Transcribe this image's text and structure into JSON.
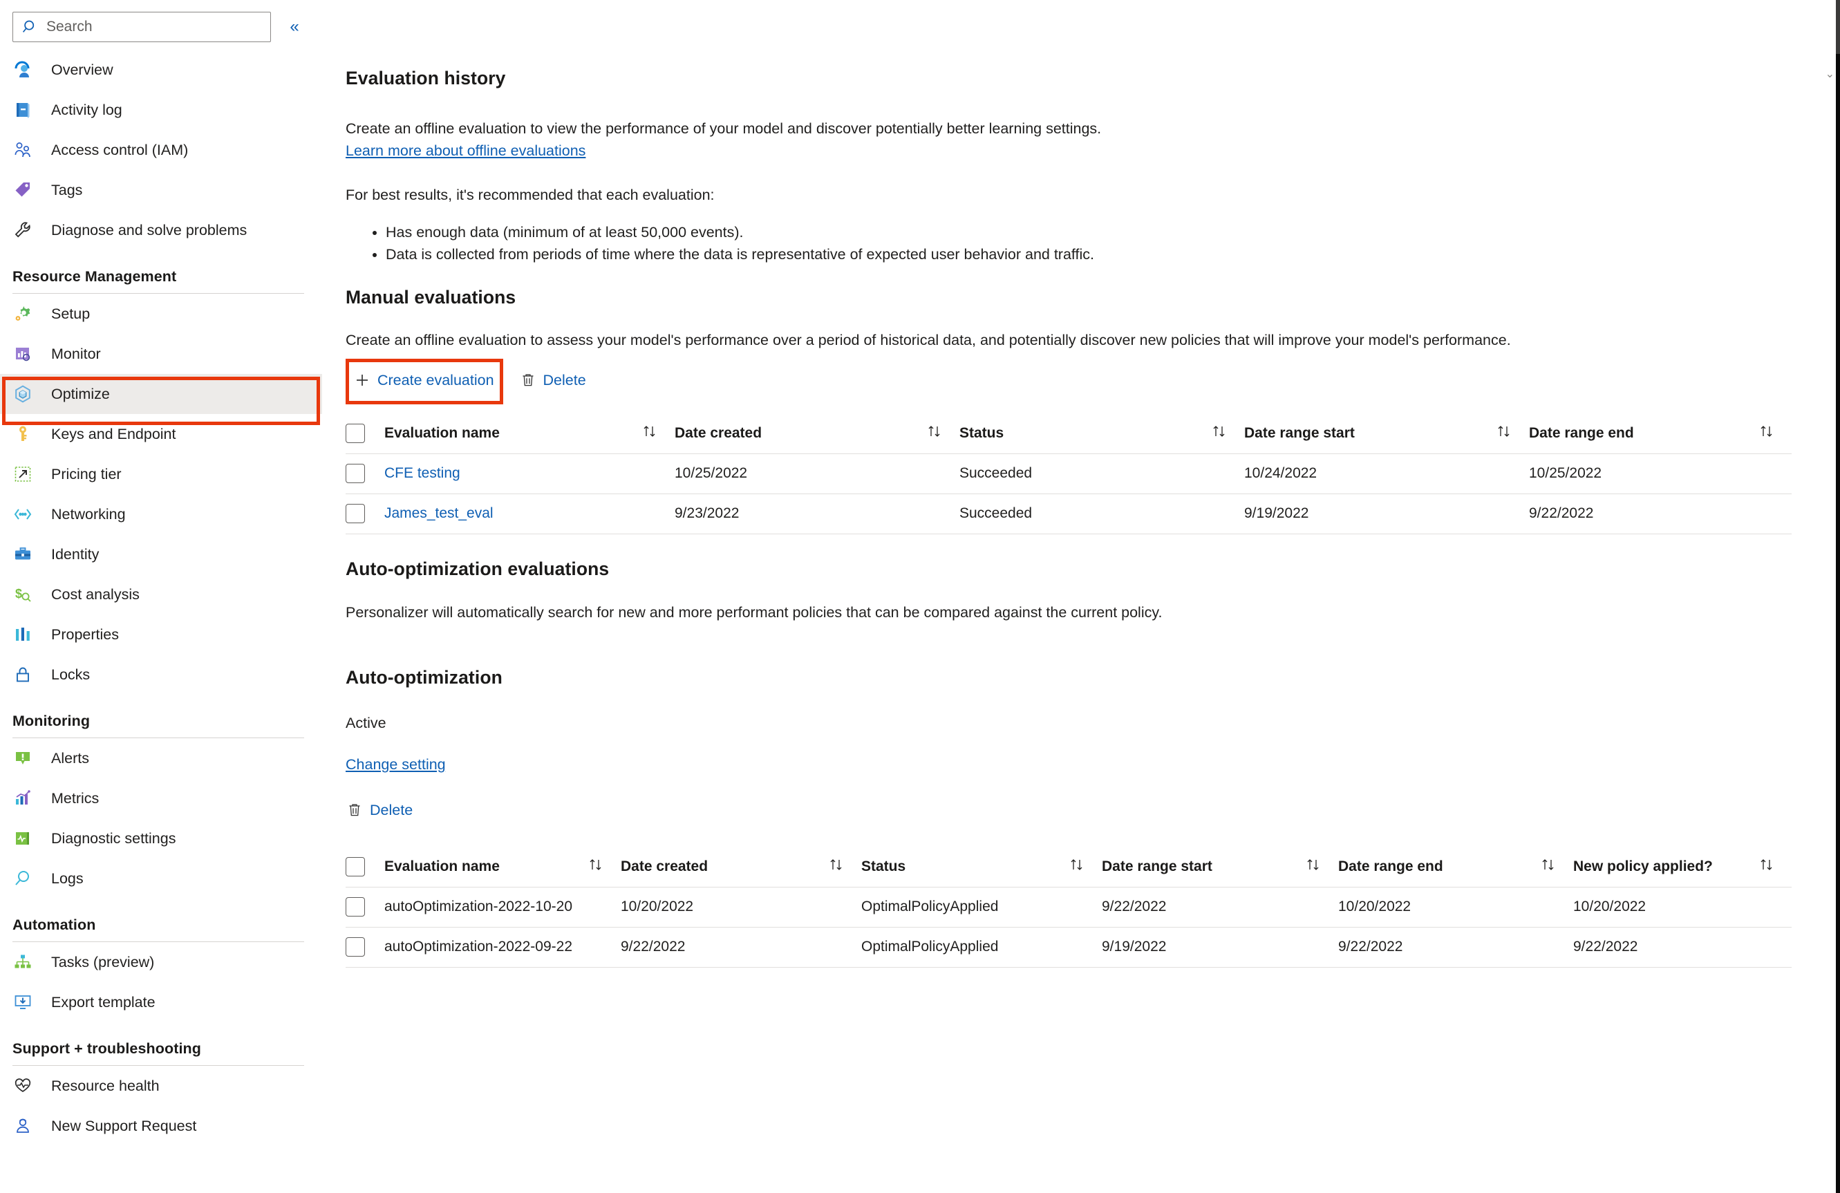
{
  "sidebar": {
    "search": {
      "placeholder": "Search",
      "icon": "search-icon"
    },
    "collapse_label": "«",
    "items": [
      {
        "label": "Overview",
        "icon": "overview-icon"
      },
      {
        "label": "Activity log",
        "icon": "activity-log-icon"
      },
      {
        "label": "Access control (IAM)",
        "icon": "access-control-icon"
      },
      {
        "label": "Tags",
        "icon": "tag-icon"
      },
      {
        "label": "Diagnose and solve problems",
        "icon": "wrench-icon"
      }
    ],
    "groups": [
      {
        "title": "Resource Management",
        "items": [
          {
            "label": "Setup",
            "icon": "gear-icon"
          },
          {
            "label": "Monitor",
            "icon": "monitor-icon"
          },
          {
            "label": "Optimize",
            "icon": "optimize-cube-icon",
            "selected": true
          },
          {
            "label": "Keys and Endpoint",
            "icon": "key-icon"
          },
          {
            "label": "Pricing tier",
            "icon": "pricing-tier-icon"
          },
          {
            "label": "Networking",
            "icon": "networking-icon"
          },
          {
            "label": "Identity",
            "icon": "identity-icon"
          },
          {
            "label": "Cost analysis",
            "icon": "cost-analysis-icon"
          },
          {
            "label": "Properties",
            "icon": "properties-icon"
          },
          {
            "label": "Locks",
            "icon": "lock-icon"
          }
        ]
      },
      {
        "title": "Monitoring",
        "items": [
          {
            "label": "Alerts",
            "icon": "alert-icon"
          },
          {
            "label": "Metrics",
            "icon": "metrics-icon"
          },
          {
            "label": "Diagnostic settings",
            "icon": "diagnostic-settings-icon"
          },
          {
            "label": "Logs",
            "icon": "logs-search-icon"
          }
        ]
      },
      {
        "title": "Automation",
        "items": [
          {
            "label": "Tasks (preview)",
            "icon": "tasks-icon"
          },
          {
            "label": "Export template",
            "icon": "export-template-icon"
          }
        ]
      },
      {
        "title": "Support + troubleshooting",
        "items": [
          {
            "label": "Resource health",
            "icon": "heart-pulse-icon"
          },
          {
            "label": "New Support Request",
            "icon": "support-person-icon"
          }
        ]
      }
    ]
  },
  "main": {
    "evaluation_history": {
      "title": "Evaluation history",
      "description": "Create an offline evaluation to view the performance of your model and discover potentially better learning settings.",
      "learn_more_link": "Learn more about offline evaluations",
      "recommendation_intro": "For best results, it's recommended that each evaluation:",
      "bullets": [
        "Has enough data (minimum of at least 50,000 events).",
        "Data is collected from periods of time where the data is representative of expected user behavior and traffic."
      ]
    },
    "manual_evaluations": {
      "title": "Manual evaluations",
      "description": "Create an offline evaluation to assess your model's performance over a period of historical data, and potentially discover new policies that will improve your model's performance.",
      "commands": [
        {
          "label": "Create evaluation",
          "glyph": "plus-icon"
        },
        {
          "label": "Delete",
          "glyph": "trash-icon"
        }
      ],
      "table": {
        "columns": [
          "Evaluation name",
          "Date created",
          "Status",
          "Date range start",
          "Date range end"
        ],
        "rows": [
          {
            "name": "CFE testing",
            "date_created": "10/25/2022",
            "status": "Succeeded",
            "date_range_start": "10/24/2022",
            "date_range_end": "10/25/2022"
          },
          {
            "name": "James_test_eval",
            "date_created": "9/23/2022",
            "status": "Succeeded",
            "date_range_start": "9/19/2022",
            "date_range_end": "9/22/2022"
          }
        ]
      }
    },
    "auto_optimization_evaluations": {
      "title": "Auto-optimization evaluations",
      "description": "Personalizer will automatically search for new and more performant policies that can be compared against the current policy."
    },
    "auto_optimization": {
      "title": "Auto-optimization",
      "status": "Active",
      "change_setting_link": "Change setting",
      "delete_label": "Delete",
      "delete_glyph": "trash-icon",
      "table": {
        "columns": [
          "Evaluation name",
          "Date created",
          "Status",
          "Date range start",
          "Date range end",
          "New policy applied?"
        ],
        "rows": [
          {
            "name": "autoOptimization-2022-10-20",
            "date_created": "10/20/2022",
            "status": "OptimalPolicyApplied",
            "date_range_start": "9/22/2022",
            "date_range_end": "10/20/2022",
            "new_policy_applied": "10/20/2022"
          },
          {
            "name": "autoOptimization-2022-09-22",
            "date_created": "9/22/2022",
            "status": "OptimalPolicyApplied",
            "date_range_start": "9/19/2022",
            "date_range_end": "9/22/2022",
            "new_policy_applied": "9/22/2022"
          }
        ]
      }
    }
  },
  "annotations": {
    "highlight_color": "#e8380d",
    "boxes": [
      "optimize-nav-highlight",
      "create-evaluation-highlight"
    ]
  },
  "colors": {
    "link": "#0f5fb3",
    "text": "#201f1e",
    "selected_row_bg": "#edebe9",
    "border": "#e1dfdd"
  }
}
